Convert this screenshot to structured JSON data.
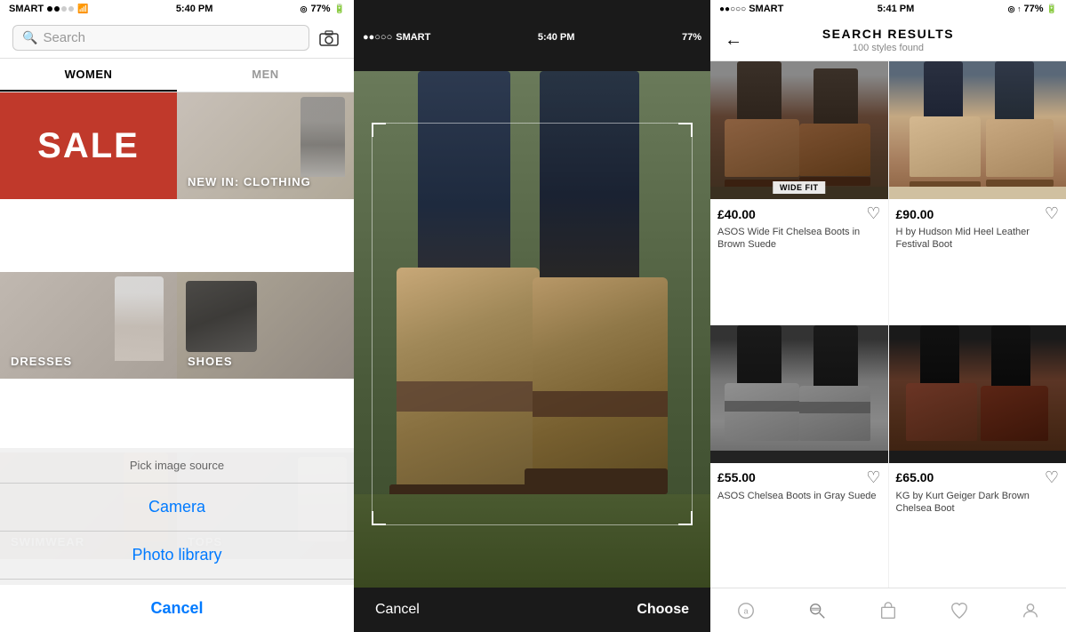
{
  "panel1": {
    "status": {
      "carrier": "SMART",
      "time": "5:40 PM",
      "battery": "77%"
    },
    "search": {
      "placeholder": "Search"
    },
    "tabs": [
      {
        "label": "WOMEN",
        "active": true
      },
      {
        "label": "MEN",
        "active": false
      }
    ],
    "grid": [
      {
        "label": "SALE",
        "type": "sale"
      },
      {
        "label": "NEW IN: CLOTHING",
        "type": "new-in"
      },
      {
        "label": "DRESSES",
        "type": "dresses"
      },
      {
        "label": "SHOES",
        "type": "shoes"
      },
      {
        "label": "SWIMWEAR",
        "type": "swimwear"
      },
      {
        "label": "TOPS",
        "type": "tops"
      }
    ],
    "actionSheet": {
      "title": "Pick image source",
      "options": [
        "Camera",
        "Photo library"
      ],
      "cancel": "Cancel"
    }
  },
  "panel2": {
    "status": {
      "carrier": "SMART",
      "time": "5:40 PM",
      "battery": "77%"
    },
    "buttons": {
      "cancel": "Cancel",
      "choose": "Choose"
    }
  },
  "panel3": {
    "status": {
      "carrier": "SMART",
      "time": "5:41 PM",
      "battery": "77%"
    },
    "header": {
      "title": "SEARCH RESULTS",
      "subtitle": "100 styles found"
    },
    "results": [
      {
        "badge": "WIDE FIT",
        "price": "£40.00",
        "name": "ASOS Wide Fit Chelsea Boots in Brown Suede",
        "type": "brown"
      },
      {
        "badge": "",
        "price": "£90.00",
        "name": "H by Hudson Mid Heel Leather Festival Boot",
        "type": "tan"
      },
      {
        "badge": "",
        "price": "£55.00",
        "name": "ASOS Chelsea Boots in Gray Suede",
        "type": "gray"
      },
      {
        "badge": "",
        "price": "£65.00",
        "name": "KG by Kurt Geiger Dark Brown Chelsea Boot",
        "type": "dark"
      }
    ],
    "nav": [
      {
        "icon": "a",
        "label": "home",
        "active": false
      },
      {
        "icon": "≡◎",
        "label": "search",
        "active": false
      },
      {
        "icon": "⬜",
        "label": "bag",
        "active": false
      },
      {
        "icon": "♡",
        "label": "saved",
        "active": false
      },
      {
        "icon": "👤",
        "label": "profile",
        "active": false
      }
    ]
  }
}
